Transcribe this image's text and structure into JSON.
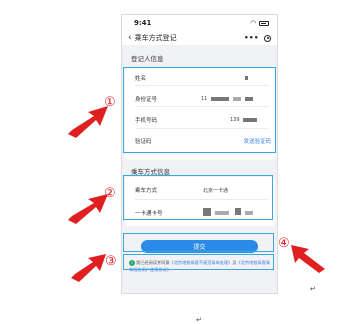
{
  "status_bar": {
    "time": "9:41",
    "wifi_icon": "wifi-icon",
    "battery_icon": "battery-icon"
  },
  "nav": {
    "back_icon": "chevron-left-icon",
    "title": "乘车方式登记",
    "more_label": "•••"
  },
  "registrant_section": {
    "title": "登记人信息",
    "name_label": "姓名",
    "id_label": "身份证号",
    "id_prefix": "11",
    "phone_label": "手机号码",
    "phone_prefix": "139",
    "code_label": "验证码",
    "send_code_label": "发送验证码"
  },
  "ride_section": {
    "title": "乘车方式信息",
    "mode_label": "乘车方式",
    "mode_value": "北京一卡通",
    "card_label": "一卡通卡号"
  },
  "submit_label": "提交",
  "agreement": {
    "prefix": "我已经阅读并同意",
    "link1": "《北京地铁乘客不规范乘车处理》",
    "middle": "及",
    "link2": "《北京地铁乘客乘车服务用户使用协议》"
  },
  "annotations": {
    "callout_1": "①",
    "callout_2": "②",
    "callout_3": "③",
    "callout_4": "④",
    "return_mark_1": "↵",
    "return_mark_2": "↵"
  },
  "colors": {
    "highlight": "#3aa8e0",
    "arrow": "#e02020",
    "primary": "#2a8ae8",
    "link": "#3b7de0",
    "check": "#2aa865"
  }
}
